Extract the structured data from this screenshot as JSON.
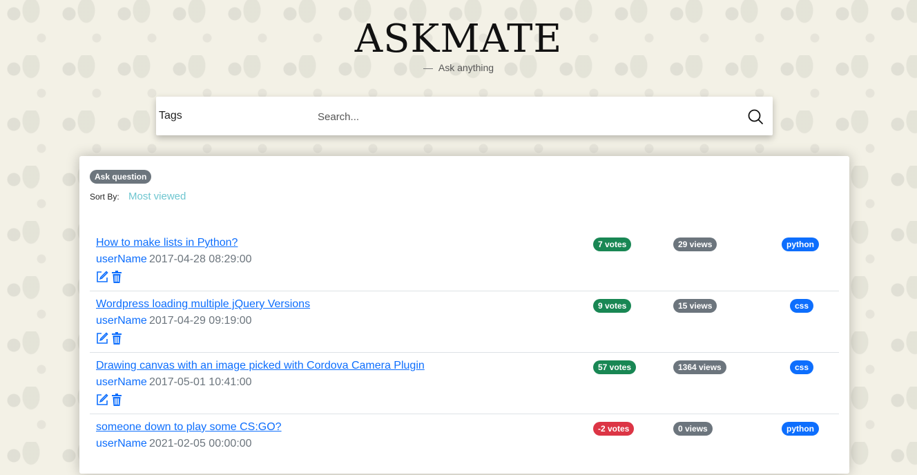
{
  "header": {
    "logo": "ASKMATE",
    "tagline": "Ask anything"
  },
  "search": {
    "tags_label": "Tags",
    "placeholder": "Search..."
  },
  "toolbar": {
    "ask_label": "Ask question",
    "sort_label": "Sort By:",
    "sort_value": "Most viewed"
  },
  "questions": [
    {
      "title": "How to make lists in Python?",
      "user": "userName",
      "date": "2017-04-28 08:29:00",
      "votes": "7 votes",
      "views": "29 views",
      "tag": "python"
    },
    {
      "title": "Wordpress loading multiple jQuery Versions",
      "user": "userName",
      "date": "2017-04-29 09:19:00",
      "votes": "9 votes",
      "views": "15 views",
      "tag": "css"
    },
    {
      "title": "Drawing canvas with an image picked with Cordova Camera Plugin",
      "user": "userName",
      "date": "2017-05-01 10:41:00",
      "votes": "57 votes",
      "views": "1364 views",
      "tag": "css"
    },
    {
      "title": "someone down to play some CS:GO?",
      "user": "userName",
      "date": "2021-02-05 00:00:00",
      "votes": "-2 votes",
      "views": "0 views",
      "tag": "python"
    }
  ],
  "colors": {
    "positive_votes": "#198754",
    "negative_votes": "#dc3545",
    "views": "#6c757d",
    "tag": "#0d6efd",
    "link": "#0d6efd",
    "sort_link": "#6ec6d0"
  }
}
